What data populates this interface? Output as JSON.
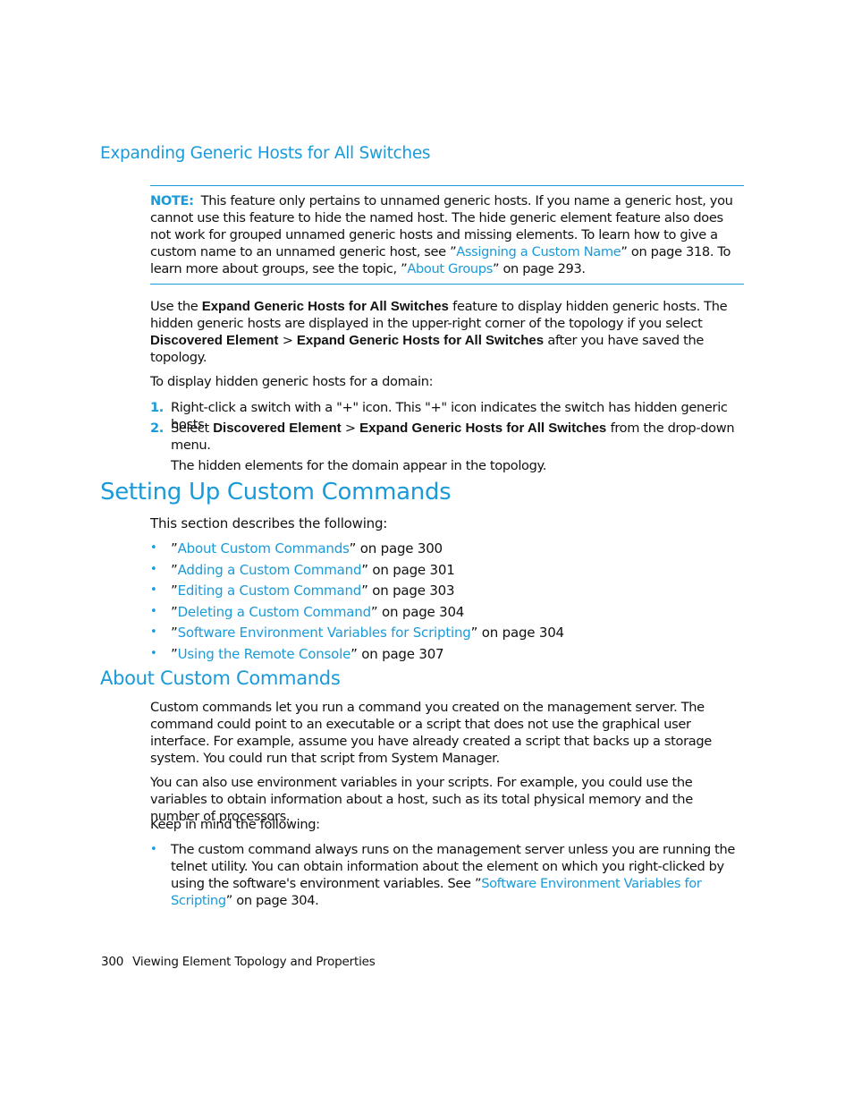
{
  "subsection_title": "Expanding Generic Hosts for All Switches",
  "note": {
    "label": "NOTE:",
    "text_1": "This feature only pertains to unnamed generic hosts. If you name a generic host, you cannot use this feature to hide the named host. The hide generic element feature also does not work for grouped unnamed generic hosts and missing elements. To learn how to give a custom name to an unnamed generic host, see ”",
    "link_1": "Assigning a Custom Name",
    "text_2": "” on page 318. To learn more about groups, see the topic, ”",
    "link_2": "About Groups",
    "text_3": "” on page 293."
  },
  "intro": {
    "p1_a": "Use the ",
    "p1_b": "Expand Generic Hosts for All Switches",
    "p1_c": " feature to display hidden generic hosts. The hidden generic hosts are displayed in the upper-right corner of the topology if you select ",
    "p1_d": "Discovered Element",
    "p1_e": " > ",
    "p1_f": "Expand Generic Hosts for All Switches",
    "p1_g": " after you have saved the topology.",
    "p2": "To display hidden generic hosts for a domain:"
  },
  "steps": [
    {
      "num": "1.",
      "text": "Right-click a switch with a \"+\" icon. This \"+\" icon indicates the switch has hidden generic hosts."
    },
    {
      "num": "2.",
      "text_a": "Select ",
      "bold_a": "Discovered Element",
      "text_b": " > ",
      "bold_b": "Expand Generic Hosts for All Switches",
      "text_c": " from the drop-down menu.",
      "result": "The hidden elements for the domain appear in the topology."
    }
  ],
  "section_title": "Setting Up Custom Commands",
  "section_intro": "This section describes the following:",
  "toc": [
    {
      "link": "About Custom Commands",
      "suffix": "” on page 300"
    },
    {
      "link": "Adding a Custom Command",
      "suffix": "” on page 301"
    },
    {
      "link": "Editing a Custom Command",
      "suffix": "” on page 303"
    },
    {
      "link": "Deleting a Custom Command",
      "suffix": "” on page 304"
    },
    {
      "link": "Software Environment Variables for Scripting",
      "suffix": "” on page 304"
    },
    {
      "link": "Using the Remote Console",
      "suffix": "” on page 307"
    }
  ],
  "toc_prefix": "”",
  "bullet_glyph": "•",
  "about": {
    "title": "About Custom Commands",
    "p1": "Custom commands let you run a command you created on the management server. The command could point to an executable or a script that does not use the graphical user interface. For example, assume you have already created a script that backs up a storage system. You could run that script from System Manager.",
    "p2": "You can also use environment variables in your scripts. For example, you could use the variables to obtain information about a host, such as its total physical memory and the number of processors.",
    "p3": "Keep in mind the following:",
    "bullet_a": "The custom command always runs on the management server unless you are running the telnet utility. You can obtain information about the element on which you right-clicked by using the software's environment variables. See ”",
    "bullet_link": "Software Environment Variables for Scripting",
    "bullet_b": "” on page 304."
  },
  "footer": {
    "page_number": "300",
    "chapter_title": "Viewing Element Topology and Properties"
  },
  "colors": {
    "accent": "#1a9ad9",
    "text": "#111111"
  }
}
